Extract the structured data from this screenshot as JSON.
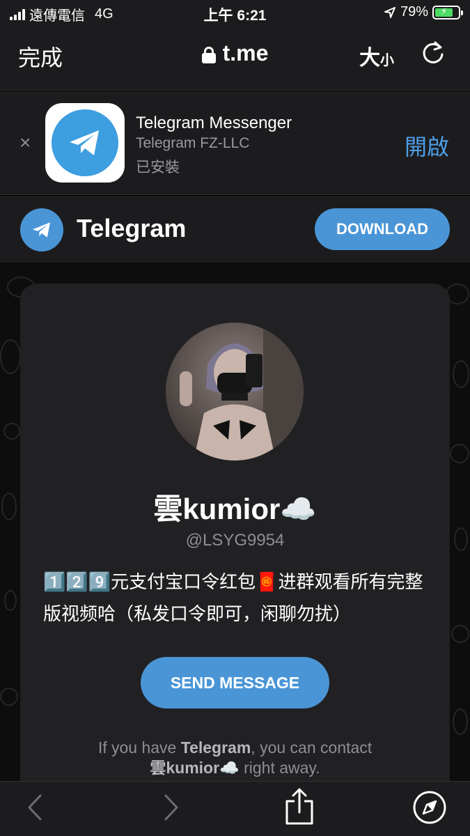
{
  "status_bar": {
    "carrier": "遠傳電信",
    "network": "4G",
    "time": "上午 6:21",
    "battery": "79%",
    "battery_level": 0.79
  },
  "nav": {
    "done_label": "完成",
    "url": "t.me",
    "text_size_big": "大",
    "text_size_small": "小"
  },
  "app_banner": {
    "close": "×",
    "app_name": "Telegram Messenger",
    "developer": "Telegram FZ-LLC",
    "status": "已安裝",
    "open_label": "開啟"
  },
  "tg_header": {
    "title": "Telegram",
    "download_label": "DOWNLOAD"
  },
  "profile": {
    "name": "雲kumior☁️",
    "username": "@LSYG9954",
    "description": "1️⃣2️⃣9️⃣元支付宝口令红包🧧进群观看所有完整版视频哈（私发口令即可，闲聊勿扰）",
    "send_label": "SEND MESSAGE",
    "contact_prefix": "If you have ",
    "contact_app": "Telegram",
    "contact_middle": ", you can contact ",
    "contact_name": "雲kumior☁️",
    "contact_suffix": " right away."
  },
  "colors": {
    "accent": "#4a95d6",
    "link": "#4d9ee8",
    "bar_bg": "#1c1c1e",
    "card_bg": "#212124"
  },
  "icons": {
    "signal": "signal-bars-icon",
    "location": "location-arrow-icon",
    "lock": "lock-icon",
    "reload": "reload-icon",
    "back": "chevron-left-icon",
    "forward": "chevron-right-icon",
    "share": "share-icon",
    "safari": "compass-icon",
    "telegram": "paper-plane-icon"
  }
}
